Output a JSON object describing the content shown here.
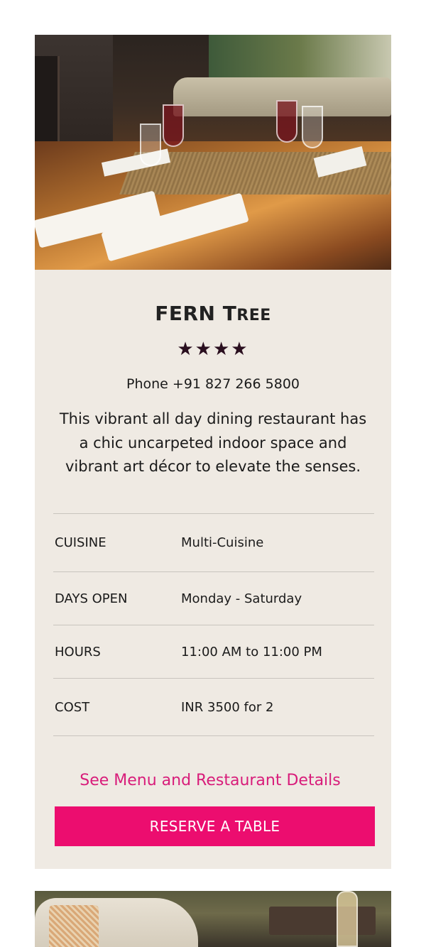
{
  "restaurant": {
    "name_first": "FERN",
    "name_second_initial": "T",
    "name_second_rest": "REE",
    "rating_stars": "★★★★",
    "rating_value": 4,
    "phone": "Phone +91 827 266 5800",
    "description": "This vibrant all day dining restaurant has a chic uncarpeted indoor space and vibrant art décor to elevate the senses."
  },
  "details": [
    {
      "label": "CUISINE",
      "value": "Multi-Cuisine"
    },
    {
      "label": "DAYS OPEN",
      "value": "Monday - Saturday"
    },
    {
      "label": "HOURS",
      "value": "11:00 AM to 11:00 PM"
    },
    {
      "label": "COST",
      "value": "INR 3500 for 2"
    }
  ],
  "actions": {
    "menu_link": "See Menu and Restaurant Details",
    "reserve_button": "RESERVE A TABLE"
  },
  "colors": {
    "accent": "#ec0d6f",
    "link": "#d81c7a",
    "card_bg": "#efeae3",
    "star": "#2a0f1f"
  }
}
